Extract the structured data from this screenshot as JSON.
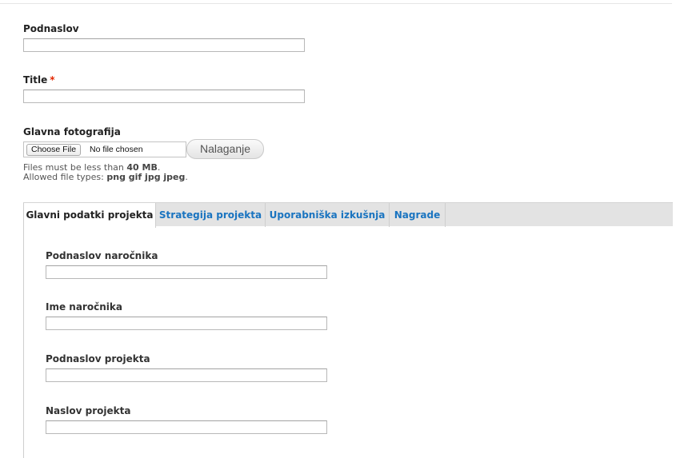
{
  "fields": {
    "podnaslov": {
      "label": "Podnaslov",
      "value": ""
    },
    "title": {
      "label": "Title",
      "required_mark": "*",
      "value": ""
    }
  },
  "photo": {
    "label": "Glavna fotografija",
    "choose_label": "Choose File",
    "no_file": "No file chosen",
    "upload_label": "Nalaganje",
    "help_size_prefix": "Files must be less than ",
    "help_size_value": "40 MB",
    "help_size_suffix": ".",
    "help_types_prefix": "Allowed file types: ",
    "help_types_value": "png gif jpg jpeg",
    "help_types_suffix": "."
  },
  "tabs": [
    {
      "label": "Glavni podatki projekta",
      "active": true
    },
    {
      "label": "Strategija projekta",
      "active": false
    },
    {
      "label": "Uporabniška izkušnja",
      "active": false
    },
    {
      "label": "Nagrade",
      "active": false
    }
  ],
  "tab_fields": [
    {
      "label": "Podnaslov naročnika",
      "value": ""
    },
    {
      "label": "Ime naročnika",
      "value": ""
    },
    {
      "label": "Podnaslov projekta",
      "value": ""
    },
    {
      "label": "Naslov projekta",
      "value": ""
    }
  ],
  "colors": {
    "link": "#1a74c0",
    "required": "#e32700",
    "tabbar": "#e3e3e3"
  }
}
